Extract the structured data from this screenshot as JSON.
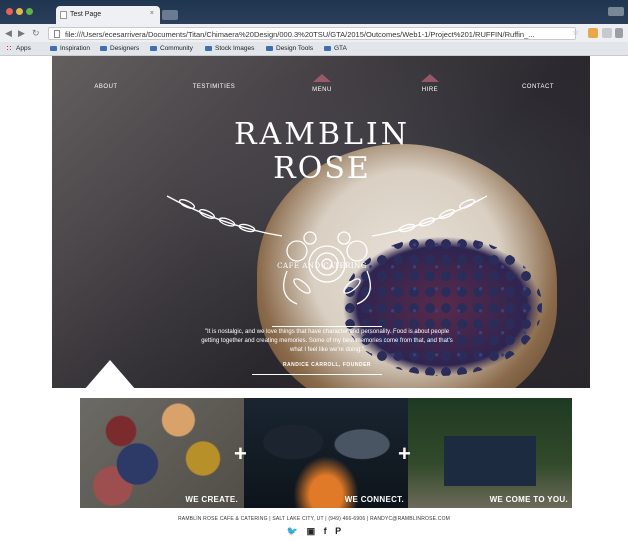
{
  "browser": {
    "tab_title": "Test Page",
    "url": "file:///Users/ecesarrivera/Documents/Titan/Chimaera%20Design/000.3%20TSU/GTA/2015/Outcomes/Web1-1/Project%201/RUFFIN/Ruffin_...",
    "bookmarks": [
      "Apps",
      "Inspiration",
      "Designers",
      "Community",
      "Stock Images",
      "Design Tools",
      "GTA"
    ]
  },
  "nav": {
    "about": "ABOUT",
    "testimonies": "TESTIMITIES",
    "menu": "MENU",
    "hire": "HIRE",
    "contact": "CONTACT"
  },
  "brand": {
    "line1": "RAMBLIN",
    "line2": "ROSE",
    "sub": "CAFE AND CATERING"
  },
  "quote": {
    "text": "\"It is nostalgic, and we love things that have character and personality. Food is about people getting together and creating memories. Some of my best memories come from that, and that's what I feel like we're doing.\"",
    "author": "RANDICE CARROLL, FOUNDER"
  },
  "panels": [
    {
      "caption": "WE CREATE."
    },
    {
      "caption": "WE CONNECT."
    },
    {
      "caption": "WE COME TO YOU."
    }
  ],
  "footer": "RAMBLIN ROSE CAFE & CATERING | SALT LAKE CITY, UT | (949) 466-6906 | RANDYC@RAMBLINROSE.COM",
  "social": [
    "twitter-icon",
    "instagram-icon",
    "facebook-icon",
    "pinterest-icon"
  ],
  "colors": {
    "accent": "#b05c6e",
    "hero": "#2c2a30"
  }
}
